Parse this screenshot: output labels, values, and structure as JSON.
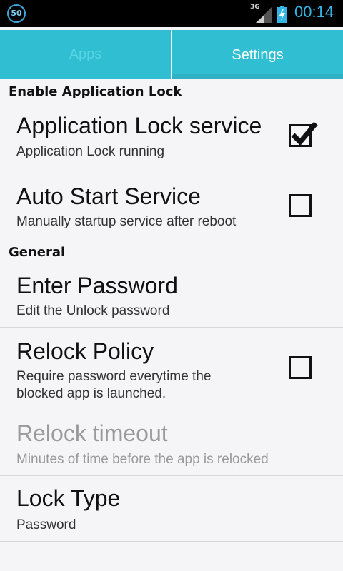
{
  "status_bar": {
    "badge": "50",
    "network": "3G",
    "time": "00:14"
  },
  "tabs": [
    {
      "label": "Apps",
      "selected": false
    },
    {
      "label": "Settings",
      "selected": true
    }
  ],
  "sections": [
    {
      "header": "Enable Application Lock"
    },
    {
      "header": "General"
    }
  ],
  "prefs": {
    "app_lock_service": {
      "title": "Application Lock service",
      "summary": "Application Lock running",
      "checked": true
    },
    "auto_start": {
      "title": "Auto Start Service",
      "summary": "Manually startup service after reboot",
      "checked": false
    },
    "enter_password": {
      "title": "Enter Password",
      "summary": "Edit the Unlock password"
    },
    "relock_policy": {
      "title": "Relock Policy",
      "summary_line1": "Require password everytime the",
      "summary_line2": "blocked app is launched.",
      "checked": false
    },
    "relock_timeout": {
      "title": "Relock timeout",
      "summary": "Minutes of time before the app is relocked",
      "enabled": false
    },
    "lock_type": {
      "title": "Lock Type",
      "summary": "Password"
    }
  }
}
